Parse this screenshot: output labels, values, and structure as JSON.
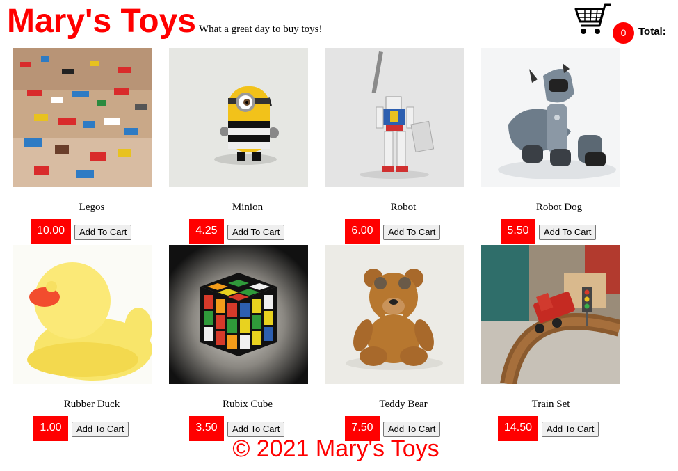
{
  "header": {
    "title": "Mary's Toys",
    "tagline": "What a great day to buy toys!",
    "cart_icon": "shopping-cart-icon",
    "cart_count": "0",
    "total_label": "Total:"
  },
  "products": [
    {
      "name": "Legos",
      "price": "10.00",
      "button": "Add To Cart",
      "image": "legos"
    },
    {
      "name": "Minion",
      "price": "4.25",
      "button": "Add To Cart",
      "image": "minion"
    },
    {
      "name": "Robot",
      "price": "6.00",
      "button": "Add To Cart",
      "image": "robot"
    },
    {
      "name": "Robot Dog",
      "price": "5.50",
      "button": "Add To Cart",
      "image": "robot-dog"
    },
    {
      "name": "Rubber Duck",
      "price": "1.00",
      "button": "Add To Cart",
      "image": "rubber-duck"
    },
    {
      "name": "Rubix Cube",
      "price": "3.50",
      "button": "Add To Cart",
      "image": "rubix-cube"
    },
    {
      "name": "Teddy Bear",
      "price": "7.50",
      "button": "Add To Cart",
      "image": "teddy-bear"
    },
    {
      "name": "Train Set",
      "price": "14.50",
      "button": "Add To Cart",
      "image": "train-set"
    }
  ],
  "footer": {
    "text": "© 2021 Mary's Toys"
  },
  "colors": {
    "accent": "#ff0000",
    "background": "#ffffff"
  }
}
